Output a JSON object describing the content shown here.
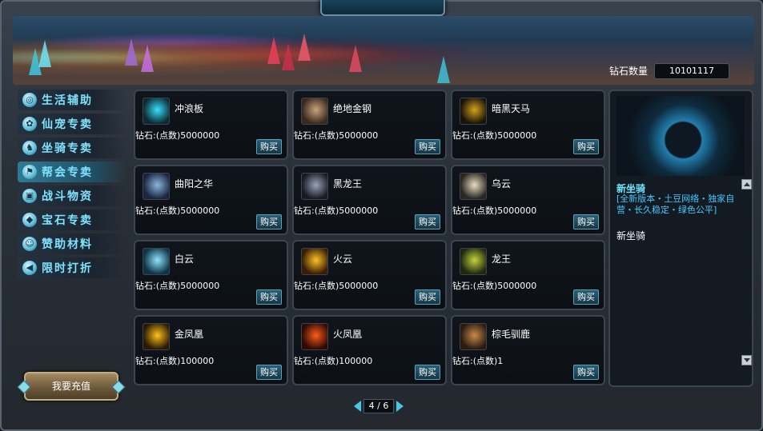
{
  "header": {
    "close_icon": "close-icon",
    "diamond_label": "钻石数量",
    "diamond_value": "10101117"
  },
  "sidebar": {
    "items": [
      {
        "label": "生活辅助",
        "icon": "swirl-icon",
        "active": false
      },
      {
        "label": "仙宠专卖",
        "icon": "paw-icon",
        "active": false
      },
      {
        "label": "坐骑专卖",
        "icon": "horse-icon",
        "active": false
      },
      {
        "label": "帮会专卖",
        "icon": "flag-icon",
        "active": true
      },
      {
        "label": "战斗物资",
        "icon": "crate-icon",
        "active": false
      },
      {
        "label": "宝石专卖",
        "icon": "gem-icon",
        "active": false
      },
      {
        "label": "赞助材料",
        "icon": "person-icon",
        "active": false
      },
      {
        "label": "限时打折",
        "icon": "megaphone-icon",
        "active": false
      }
    ],
    "recharge_label": "我要充值"
  },
  "items": [
    {
      "name": "冲浪板",
      "price": "钻石:(点数)5000000",
      "buy": "购买",
      "colors": [
        "#0d2b33",
        "#36e0ff"
      ]
    },
    {
      "name": "绝地金钢",
      "price": "钻石:(点数)5000000",
      "buy": "购买",
      "colors": [
        "#3a2a1e",
        "#c9a37a"
      ]
    },
    {
      "name": "暗黑天马",
      "price": "钻石:(点数)5000000",
      "buy": "购买",
      "colors": [
        "#1a1408",
        "#d4a21a"
      ]
    },
    {
      "name": "曲阳之华",
      "price": "钻石:(点数)5000000",
      "buy": "购买",
      "colors": [
        "#1b2440",
        "#8ab7e0"
      ]
    },
    {
      "name": "黑龙王",
      "price": "钻石:(点数)5000000",
      "buy": "购买",
      "colors": [
        "#1a1a24",
        "#9aa3b8"
      ]
    },
    {
      "name": "乌云",
      "price": "钻石:(点数)5000000",
      "buy": "购买",
      "colors": [
        "#2a2620",
        "#e8dcc2"
      ]
    },
    {
      "name": "白云",
      "price": "钻石:(点数)5000000",
      "buy": "购买",
      "colors": [
        "#0e3346",
        "#8fe4ff"
      ]
    },
    {
      "name": "火云",
      "price": "钻石:(点数)5000000",
      "buy": "购买",
      "colors": [
        "#3a1c06",
        "#ffc226"
      ]
    },
    {
      "name": "龙王",
      "price": "钻石:(点数)5000000",
      "buy": "购买",
      "colors": [
        "#1e2a10",
        "#c6d23a"
      ]
    },
    {
      "name": "金凤凰",
      "price": "钻石:(点数)100000",
      "buy": "购买",
      "colors": [
        "#2a1a04",
        "#ffc21a"
      ]
    },
    {
      "name": "火凤凰",
      "price": "钻石:(点数)100000",
      "buy": "购买",
      "colors": [
        "#2e0a04",
        "#ff5a1a"
      ]
    },
    {
      "name": "棕毛驯鹿",
      "price": "钻石:(点数)1",
      "buy": "购买",
      "colors": [
        "#2a1a10",
        "#c98a4a"
      ]
    }
  ],
  "pager": {
    "label": "4 / 6"
  },
  "detail": {
    "title": "新坐骑",
    "desc": "[全新版本・土豆网络・独家自营・长久稳定・绿色公平]",
    "name": "新坐骑"
  }
}
